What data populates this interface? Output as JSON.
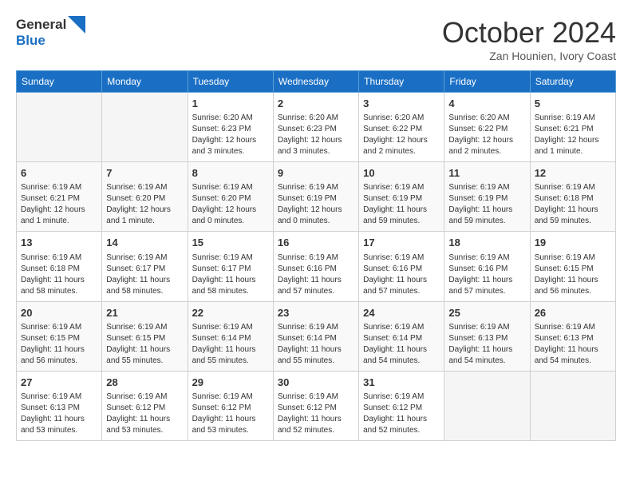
{
  "logo": {
    "line1": "General",
    "line2": "Blue"
  },
  "title": "October 2024",
  "subtitle": "Zan Hounien, Ivory Coast",
  "weekdays": [
    "Sunday",
    "Monday",
    "Tuesday",
    "Wednesday",
    "Thursday",
    "Friday",
    "Saturday"
  ],
  "weeks": [
    [
      {
        "day": "",
        "info": ""
      },
      {
        "day": "",
        "info": ""
      },
      {
        "day": "1",
        "info": "Sunrise: 6:20 AM\nSunset: 6:23 PM\nDaylight: 12 hours and 3 minutes."
      },
      {
        "day": "2",
        "info": "Sunrise: 6:20 AM\nSunset: 6:23 PM\nDaylight: 12 hours and 3 minutes."
      },
      {
        "day": "3",
        "info": "Sunrise: 6:20 AM\nSunset: 6:22 PM\nDaylight: 12 hours and 2 minutes."
      },
      {
        "day": "4",
        "info": "Sunrise: 6:20 AM\nSunset: 6:22 PM\nDaylight: 12 hours and 2 minutes."
      },
      {
        "day": "5",
        "info": "Sunrise: 6:19 AM\nSunset: 6:21 PM\nDaylight: 12 hours and 1 minute."
      }
    ],
    [
      {
        "day": "6",
        "info": "Sunrise: 6:19 AM\nSunset: 6:21 PM\nDaylight: 12 hours and 1 minute."
      },
      {
        "day": "7",
        "info": "Sunrise: 6:19 AM\nSunset: 6:20 PM\nDaylight: 12 hours and 1 minute."
      },
      {
        "day": "8",
        "info": "Sunrise: 6:19 AM\nSunset: 6:20 PM\nDaylight: 12 hours and 0 minutes."
      },
      {
        "day": "9",
        "info": "Sunrise: 6:19 AM\nSunset: 6:19 PM\nDaylight: 12 hours and 0 minutes."
      },
      {
        "day": "10",
        "info": "Sunrise: 6:19 AM\nSunset: 6:19 PM\nDaylight: 11 hours and 59 minutes."
      },
      {
        "day": "11",
        "info": "Sunrise: 6:19 AM\nSunset: 6:19 PM\nDaylight: 11 hours and 59 minutes."
      },
      {
        "day": "12",
        "info": "Sunrise: 6:19 AM\nSunset: 6:18 PM\nDaylight: 11 hours and 59 minutes."
      }
    ],
    [
      {
        "day": "13",
        "info": "Sunrise: 6:19 AM\nSunset: 6:18 PM\nDaylight: 11 hours and 58 minutes."
      },
      {
        "day": "14",
        "info": "Sunrise: 6:19 AM\nSunset: 6:17 PM\nDaylight: 11 hours and 58 minutes."
      },
      {
        "day": "15",
        "info": "Sunrise: 6:19 AM\nSunset: 6:17 PM\nDaylight: 11 hours and 58 minutes."
      },
      {
        "day": "16",
        "info": "Sunrise: 6:19 AM\nSunset: 6:16 PM\nDaylight: 11 hours and 57 minutes."
      },
      {
        "day": "17",
        "info": "Sunrise: 6:19 AM\nSunset: 6:16 PM\nDaylight: 11 hours and 57 minutes."
      },
      {
        "day": "18",
        "info": "Sunrise: 6:19 AM\nSunset: 6:16 PM\nDaylight: 11 hours and 57 minutes."
      },
      {
        "day": "19",
        "info": "Sunrise: 6:19 AM\nSunset: 6:15 PM\nDaylight: 11 hours and 56 minutes."
      }
    ],
    [
      {
        "day": "20",
        "info": "Sunrise: 6:19 AM\nSunset: 6:15 PM\nDaylight: 11 hours and 56 minutes."
      },
      {
        "day": "21",
        "info": "Sunrise: 6:19 AM\nSunset: 6:15 PM\nDaylight: 11 hours and 55 minutes."
      },
      {
        "day": "22",
        "info": "Sunrise: 6:19 AM\nSunset: 6:14 PM\nDaylight: 11 hours and 55 minutes."
      },
      {
        "day": "23",
        "info": "Sunrise: 6:19 AM\nSunset: 6:14 PM\nDaylight: 11 hours and 55 minutes."
      },
      {
        "day": "24",
        "info": "Sunrise: 6:19 AM\nSunset: 6:14 PM\nDaylight: 11 hours and 54 minutes."
      },
      {
        "day": "25",
        "info": "Sunrise: 6:19 AM\nSunset: 6:13 PM\nDaylight: 11 hours and 54 minutes."
      },
      {
        "day": "26",
        "info": "Sunrise: 6:19 AM\nSunset: 6:13 PM\nDaylight: 11 hours and 54 minutes."
      }
    ],
    [
      {
        "day": "27",
        "info": "Sunrise: 6:19 AM\nSunset: 6:13 PM\nDaylight: 11 hours and 53 minutes."
      },
      {
        "day": "28",
        "info": "Sunrise: 6:19 AM\nSunset: 6:12 PM\nDaylight: 11 hours and 53 minutes."
      },
      {
        "day": "29",
        "info": "Sunrise: 6:19 AM\nSunset: 6:12 PM\nDaylight: 11 hours and 53 minutes."
      },
      {
        "day": "30",
        "info": "Sunrise: 6:19 AM\nSunset: 6:12 PM\nDaylight: 11 hours and 52 minutes."
      },
      {
        "day": "31",
        "info": "Sunrise: 6:19 AM\nSunset: 6:12 PM\nDaylight: 11 hours and 52 minutes."
      },
      {
        "day": "",
        "info": ""
      },
      {
        "day": "",
        "info": ""
      }
    ]
  ]
}
